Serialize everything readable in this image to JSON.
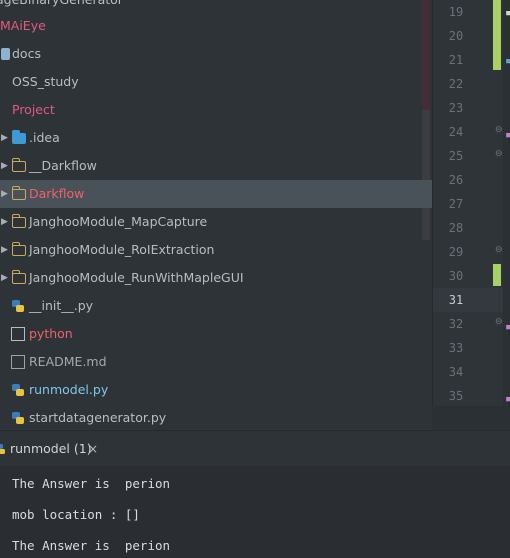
{
  "project_tree": {
    "items": [
      {
        "label": "ageBinaryGenerator",
        "color": "#b8bdc2",
        "icon": "none"
      },
      {
        "label": "MAiEye",
        "color": "#e25a7a",
        "icon": "none"
      },
      {
        "label": "docs",
        "color": "#b8bdc2",
        "icon": "doc-icon"
      },
      {
        "label": "OSS_study",
        "color": "#b8bdc2",
        "icon": "none"
      },
      {
        "label": "Project",
        "color": "#e25a7a",
        "icon": "none"
      },
      {
        "label": ".idea",
        "color": "#b8bdc2",
        "icon": "folder-blue-icon"
      },
      {
        "label": "__Darkflow",
        "color": "#b8bdc2",
        "icon": "folder-icon"
      },
      {
        "label": "Darkflow",
        "color": "#ef6168",
        "icon": "folder-icon"
      },
      {
        "label": "JanghooModule_MapCapture",
        "color": "#b8bdc2",
        "icon": "folder-icon"
      },
      {
        "label": "JanghooModule_RoIExtraction",
        "color": "#b8bdc2",
        "icon": "folder-icon"
      },
      {
        "label": "JanghooModule_RunWithMapleGUI",
        "color": "#b8bdc2",
        "icon": "folder-icon"
      },
      {
        "label": "__init__.py",
        "color": "#b8bdc2",
        "icon": "python-icon"
      },
      {
        "label": "python",
        "color": "#ef6168",
        "icon": "book-icon"
      },
      {
        "label": "README.md",
        "color": "#a3a9ae",
        "icon": "file-icon"
      },
      {
        "label": "runmodel.py",
        "color": "#7fc6e9",
        "icon": "python-icon"
      },
      {
        "label": "startdatagenerator.py",
        "color": "#b8bdc2",
        "icon": "python-icon"
      }
    ]
  },
  "editor": {
    "line_numbers": [
      "19",
      "20",
      "21",
      "22",
      "23",
      "24",
      "25",
      "26",
      "27",
      "28",
      "29",
      "30",
      "31",
      "32",
      "33",
      "34",
      "35"
    ],
    "current_line": "31"
  },
  "run_panel": {
    "tab_label": "runmodel (1)",
    "close_glyph": "×",
    "console_lines": [
      "The Answer is  perion",
      "mob location : []",
      "The Answer is  perion"
    ]
  },
  "colors": {
    "selected_row": "#4a5259",
    "accent_green": "#a7d067"
  }
}
